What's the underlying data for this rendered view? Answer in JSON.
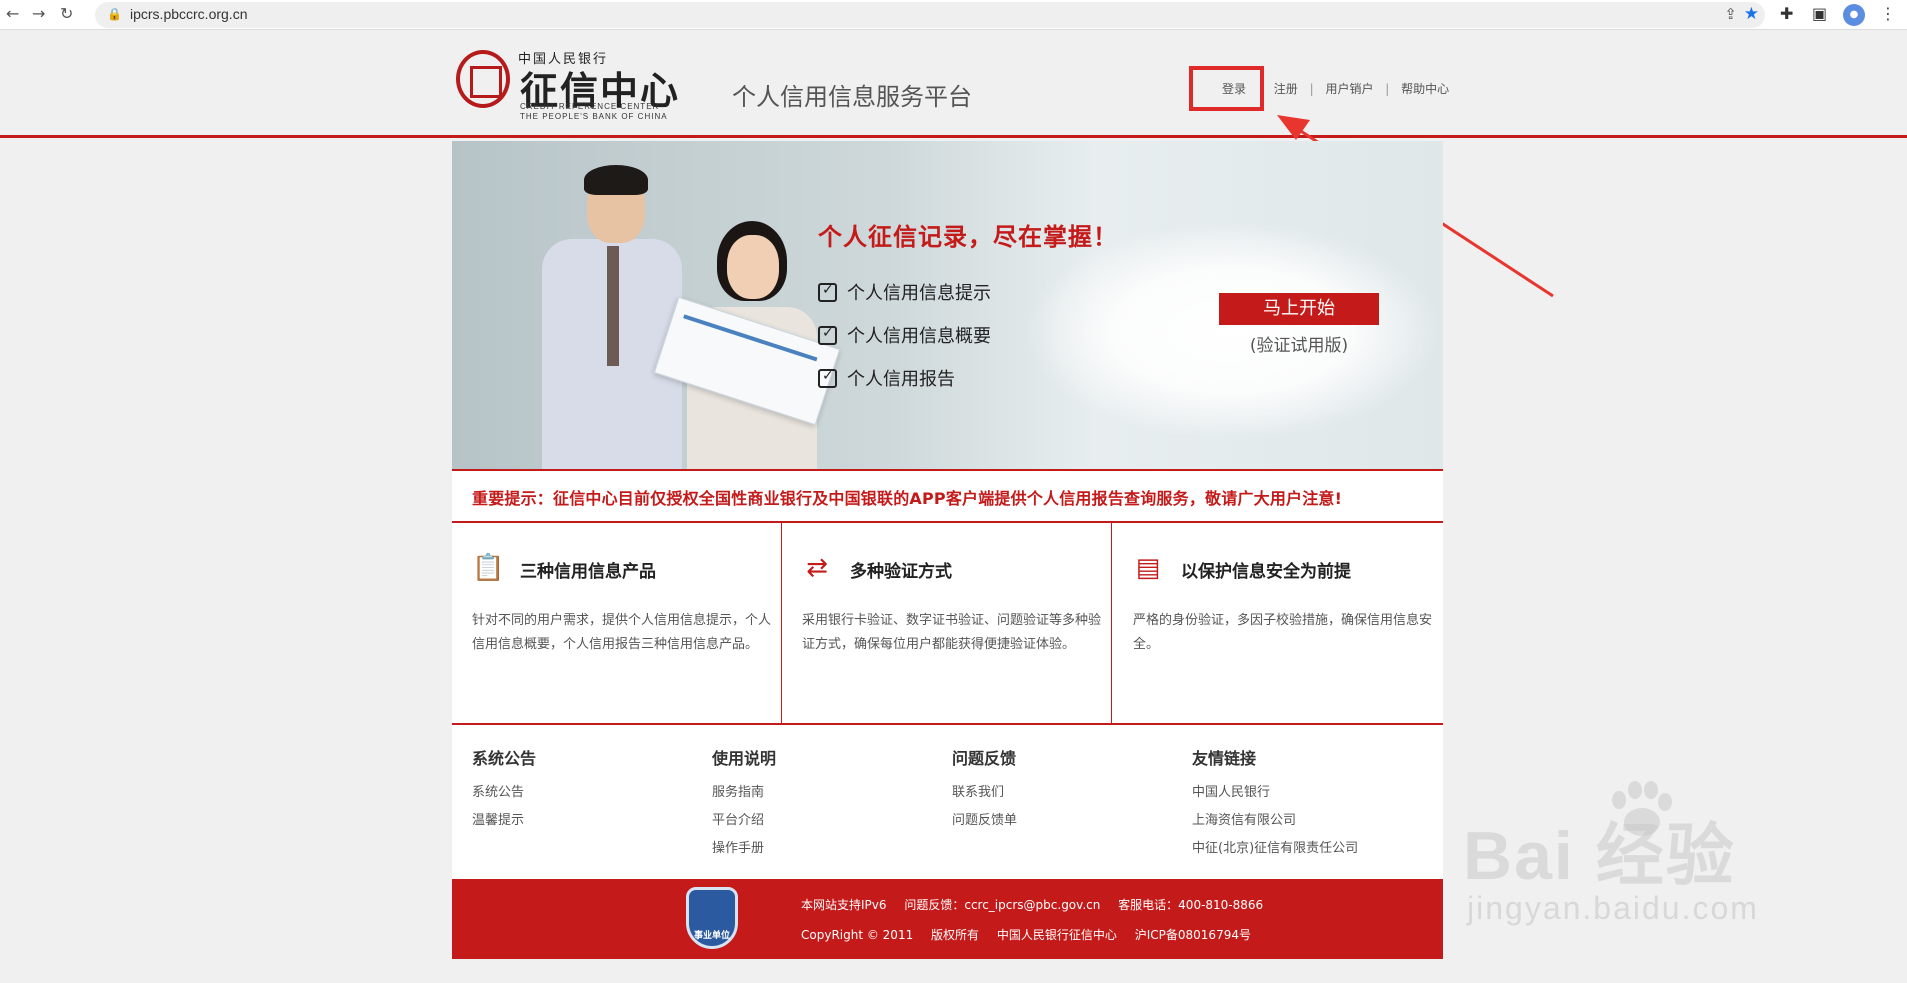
{
  "browser": {
    "url": "ipcrs.pbccrc.org.cn",
    "back_icon": "arrow-left-icon",
    "forward_icon": "arrow-right-icon",
    "reload_icon": "reload-icon"
  },
  "header": {
    "logo_top": "中国人民银行",
    "logo_main": "征信中心",
    "logo_en_line1": "CREDIT REFERENCE CENTER",
    "logo_en_line2": "THE PEOPLE'S BANK OF CHINA",
    "platform_title": "个人信用信息服务平台",
    "links": {
      "login": "登录",
      "register": "注册",
      "cancel_account": "用户销户",
      "help": "帮助中心",
      "separator": "|"
    }
  },
  "banner": {
    "headline": "个人征信记录，尽在掌握！",
    "features": [
      "个人信用信息提示",
      "个人信用信息概要",
      "个人信用报告"
    ],
    "start_button": "马上开始",
    "trial_note": "(验证试用版)"
  },
  "notice": "重要提示：征信中心目前仅授权全国性商业银行及中国银联的APP客户端提供个人信用报告查询服务，敬请广大用户注意!",
  "columns": [
    {
      "icon": "clipboard-icon",
      "title": "三种信用信息产品",
      "desc": "针对不同的用户需求，提供个人信用信息提示，个人信用信息概要，个人信用报告三种信用信息产品。"
    },
    {
      "icon": "shuffle-icon",
      "title": "多种验证方式",
      "desc": "采用银行卡验证、数字证书验证、问题验证等多种验证方式，确保每位用户都能获得便捷验证体验。"
    },
    {
      "icon": "secure-card-icon",
      "title": "以保护信息安全为前提",
      "desc": "严格的身份验证，多因子校验措施，确保信用信息安全。"
    }
  ],
  "links_sections": [
    {
      "title": "系统公告",
      "items": [
        "系统公告",
        "温馨提示"
      ]
    },
    {
      "title": "使用说明",
      "items": [
        "服务指南",
        "平台介绍",
        "操作手册"
      ]
    },
    {
      "title": "问题反馈",
      "items": [
        "联系我们",
        "问题反馈单"
      ]
    },
    {
      "title": "友情链接",
      "items": [
        "中国人民银行",
        "上海资信有限公司",
        "中征(北京)征信有限责任公司"
      ]
    }
  ],
  "footer": {
    "badge": "事业单位",
    "ipv6": "本网站支持IPv6",
    "feedback": "问题反馈：ccrc_ipcrs@pbc.gov.cn",
    "hotline": "客服电话：400-810-8866",
    "copyright": "CopyRight © 2011",
    "rights": "版权所有",
    "org": "中国人民银行征信中心",
    "icp": "沪ICP备08016794号"
  },
  "watermark": {
    "brand": "Bai  经验",
    "domain": "jingyan.baidu.com"
  },
  "colors": {
    "brand_red": "#c41a1a",
    "highlight_red": "#e02a2a"
  }
}
